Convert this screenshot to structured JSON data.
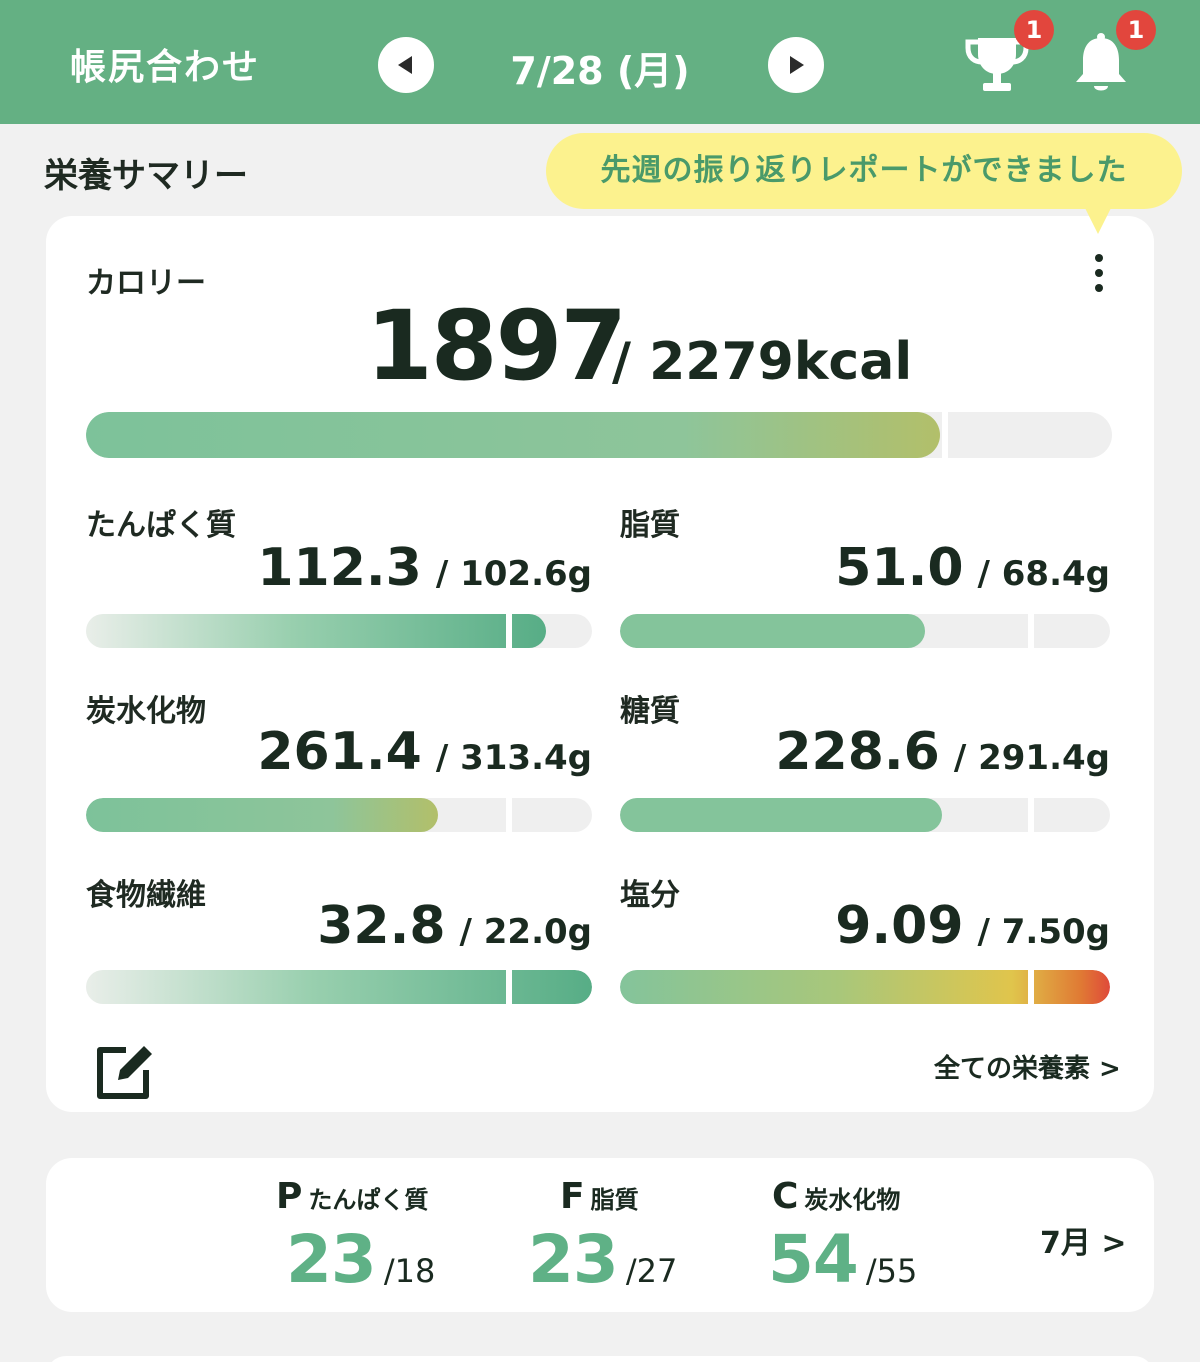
{
  "header": {
    "title": "帳尻合わせ",
    "date": "7/28 (月)",
    "trophy_badge": "1",
    "bell_badge": "1",
    "prev_icon": "triangle-left",
    "next_icon": "triangle-right",
    "color": "#64b083"
  },
  "summary": {
    "title": "栄養サマリー",
    "tooltip": "先週の振り返りレポートができました"
  },
  "calorie": {
    "label": "カロリー",
    "value": "1897",
    "target": "/ 2279kcal",
    "progress": 0.832
  },
  "nutrients": [
    {
      "label": "たんぱく質",
      "value": "112.3",
      "target": "/ 102.6g",
      "progress": 1.09
    },
    {
      "label": "脂質",
      "value": "51.0",
      "target": "/ 68.4g",
      "progress": 0.745
    },
    {
      "label": "炭水化物",
      "value": "261.4",
      "target": "/ 313.4g",
      "progress": 0.834
    },
    {
      "label": "糖質",
      "value": "228.6",
      "target": "/ 291.4g",
      "progress": 0.785
    },
    {
      "label": "食物繊維",
      "value": "32.8",
      "target": "/ 22.0g",
      "progress": 1.49
    },
    {
      "label": "塩分",
      "value": "9.09",
      "target": "/ 7.50g",
      "progress": 1.21
    }
  ],
  "footer": {
    "all_nutrients_link": "全ての栄養素 >",
    "edit_icon": "edit-icon"
  },
  "pfc": {
    "items": [
      {
        "letter": "P",
        "name": "たんぱく質",
        "value": "23",
        "target": "/18"
      },
      {
        "letter": "F",
        "name": "脂質",
        "value": "23",
        "target": "/27"
      },
      {
        "letter": "C",
        "name": "炭水化物",
        "value": "54",
        "target": "/55"
      }
    ],
    "month_link": "7月 >",
    "value_color": "#5fb186"
  }
}
